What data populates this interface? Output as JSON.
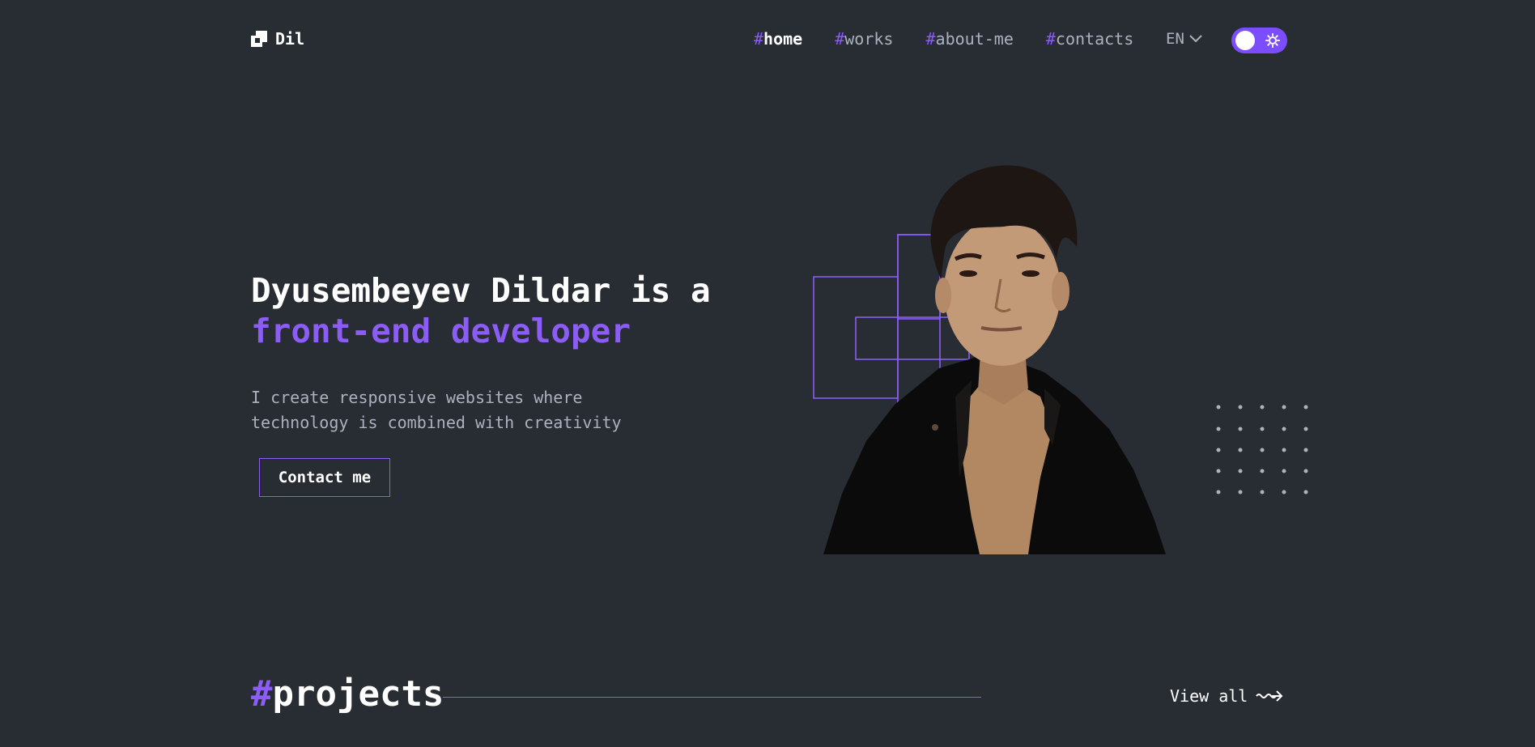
{
  "brand": {
    "name": "Dil",
    "accent_color": "#8b5cf6",
    "bg_color": "#282c33"
  },
  "nav": {
    "items": [
      {
        "hash": "#",
        "label": "home",
        "active": true
      },
      {
        "hash": "#",
        "label": "works",
        "active": false
      },
      {
        "hash": "#",
        "label": "about-me",
        "active": false
      },
      {
        "hash": "#",
        "label": "contacts",
        "active": false
      }
    ],
    "language": "EN",
    "language_icon": "chevron-down-icon",
    "theme_toggle_icon": "sun-icon"
  },
  "hero": {
    "title_line1": "Dyusembeyev Dildar is a",
    "title_line2": "front-end developer",
    "description": "I create responsive websites where technology is combined with creativity",
    "cta_label": "Contact me"
  },
  "projects": {
    "hash": "#",
    "title": "projects",
    "view_all": "View all",
    "view_all_icon": "arrow-right-icon"
  }
}
